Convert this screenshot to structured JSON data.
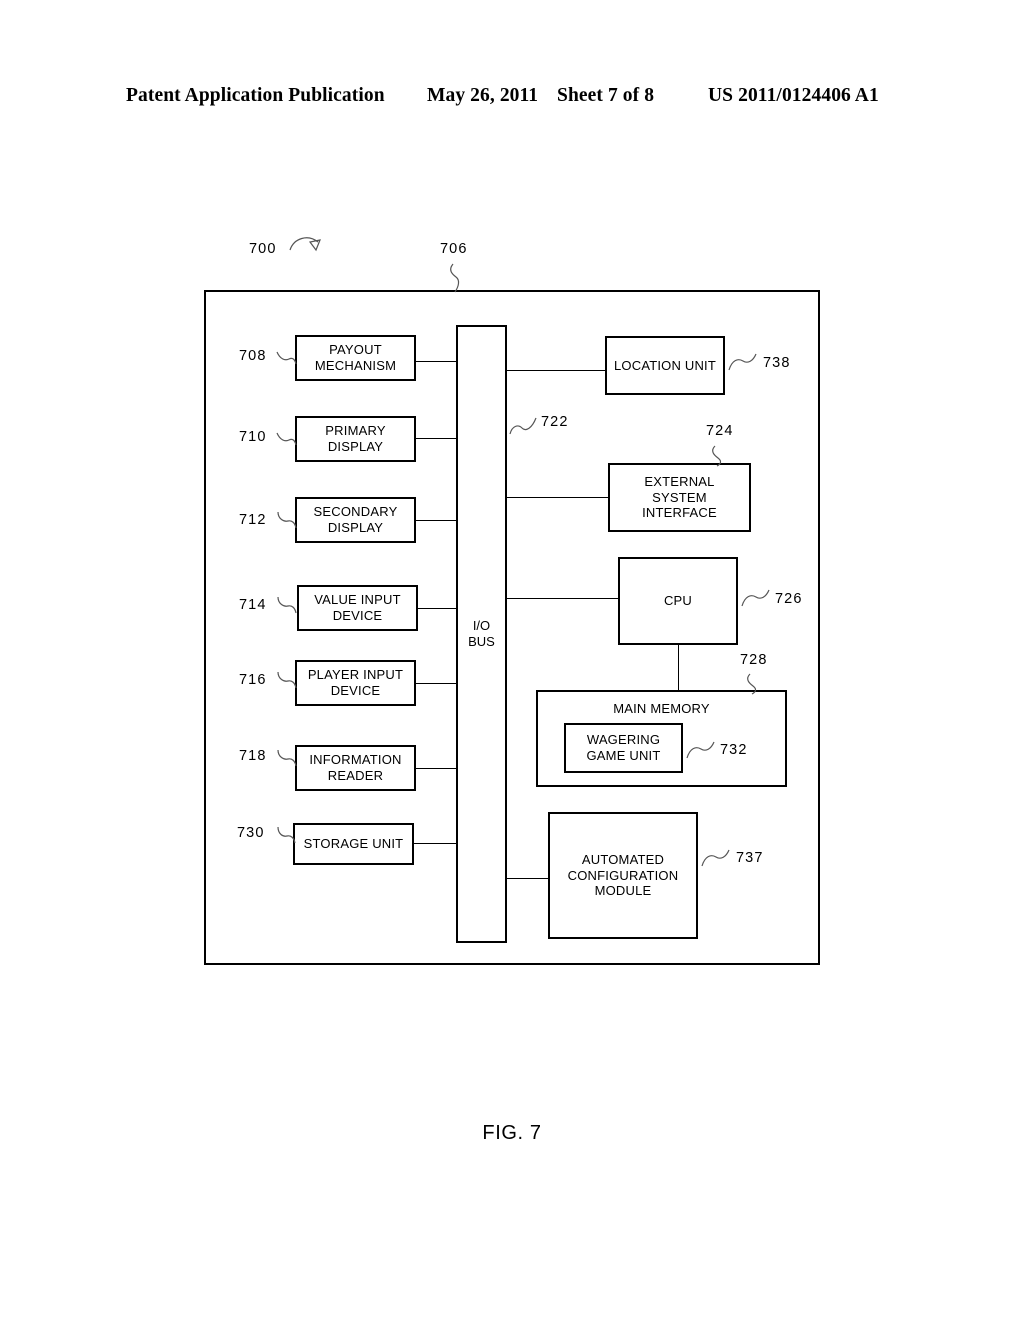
{
  "header": {
    "title": "Patent Application Publication",
    "date": "May 26, 2011",
    "sheet": "Sheet 7 of 8",
    "publication_number": "US 2011/0124406 A1"
  },
  "figure": {
    "caption": "FIG. 7",
    "system_ref": "700",
    "frame_ref": "706",
    "bus": {
      "label": "I/O\nBUS",
      "ref": "722"
    },
    "left_blocks": [
      {
        "ref": "708",
        "label": "PAYOUT\nMECHANISM"
      },
      {
        "ref": "710",
        "label": "PRIMARY\nDISPLAY"
      },
      {
        "ref": "712",
        "label": "SECONDARY\nDISPLAY"
      },
      {
        "ref": "714",
        "label": "VALUE INPUT\nDEVICE"
      },
      {
        "ref": "716",
        "label": "PLAYER INPUT\nDEVICE"
      },
      {
        "ref": "718",
        "label": "INFORMATION\nREADER"
      },
      {
        "ref": "730",
        "label": "STORAGE UNIT"
      }
    ],
    "right_blocks": [
      {
        "ref": "738",
        "label": "LOCATION UNIT"
      },
      {
        "ref": "724",
        "label": "EXTERNAL\nSYSTEM\nINTERFACE"
      },
      {
        "ref": "726",
        "label": "CPU"
      },
      {
        "ref": "728",
        "label": "MAIN MEMORY"
      },
      {
        "ref": "732",
        "label": "WAGERING\nGAME UNIT"
      },
      {
        "ref": "737",
        "label": "AUTOMATED\nCONFIGURATION\nMODULE"
      }
    ]
  }
}
